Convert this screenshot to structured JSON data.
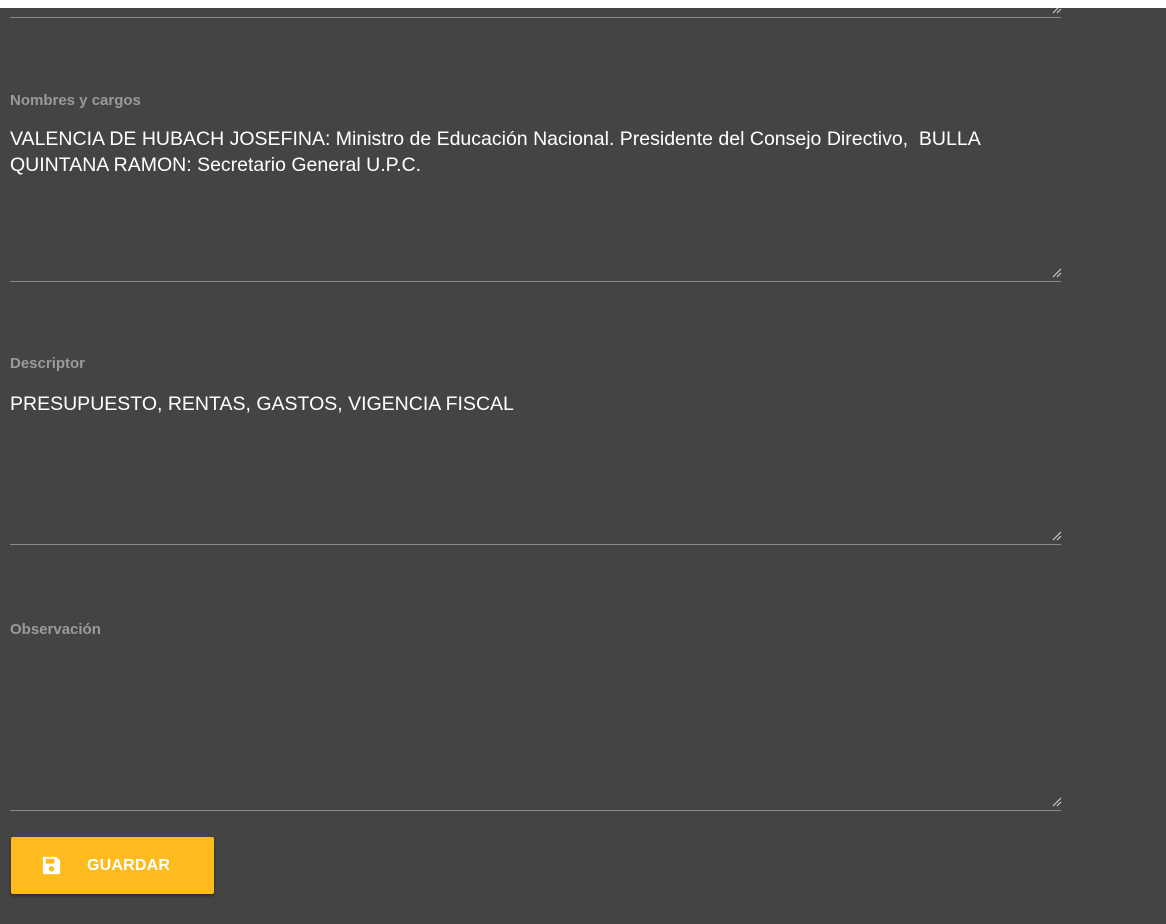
{
  "form": {
    "nombres": {
      "label": "Nombres y cargos",
      "value": "VALENCIA DE HUBACH JOSEFINA: Ministro de Educación Nacional. Presidente del Consejo Directivo,  BULLA QUINTANA RAMON: Secretario General U.P.C."
    },
    "descriptor": {
      "label": "Descriptor",
      "value": "PRESUPUESTO, RENTAS, GASTOS, VIGENCIA FISCAL"
    },
    "observacion": {
      "label": "Observación",
      "value": ""
    },
    "save_button": {
      "label": "GUARDAR",
      "icon": "floppy-disk-icon"
    }
  },
  "colors": {
    "background": "#444444",
    "label": "#9a9a9a",
    "text": "#ffffff",
    "underline": "#8a8a8a",
    "accent": "#fdbb1d"
  }
}
